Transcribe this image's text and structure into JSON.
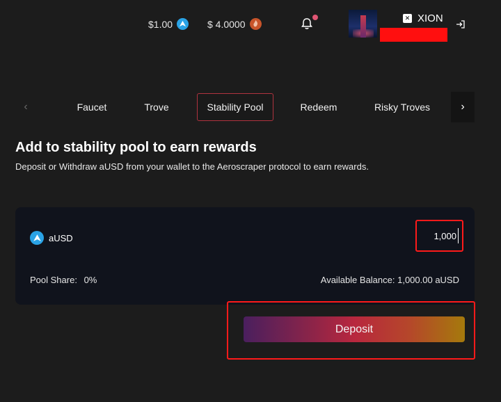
{
  "header": {
    "ausd_price": "$1.00",
    "xion_price": "$ 4.0000",
    "wallet_name": "XION",
    "colors": {
      "ausd_coin": "#2aa3e6",
      "xion_coin": "#c8542a",
      "notification_dot": "#e05573"
    }
  },
  "tabs": [
    {
      "label": "Faucet"
    },
    {
      "label": "Trove"
    },
    {
      "label": "Stability Pool",
      "active": true
    },
    {
      "label": "Redeem"
    },
    {
      "label": "Risky Troves"
    }
  ],
  "page": {
    "title": "Add to stability pool to earn rewards",
    "subtitle": "Deposit or Withdraw aUSD from your wallet to the Aeroscraper protocol to earn rewards."
  },
  "form": {
    "token_label": "aUSD",
    "amount_value": "1,000",
    "pool_share_label": "Pool Share:",
    "pool_share_value": "0%",
    "available_balance": "Available Balance: 1,000.00 aUSD",
    "deposit_label": "Deposit"
  },
  "icons": [
    "ausd-coin-icon",
    "xion-coin-icon",
    "bell-icon",
    "logout-icon",
    "chevron-left-icon",
    "chevron-right-icon"
  ]
}
